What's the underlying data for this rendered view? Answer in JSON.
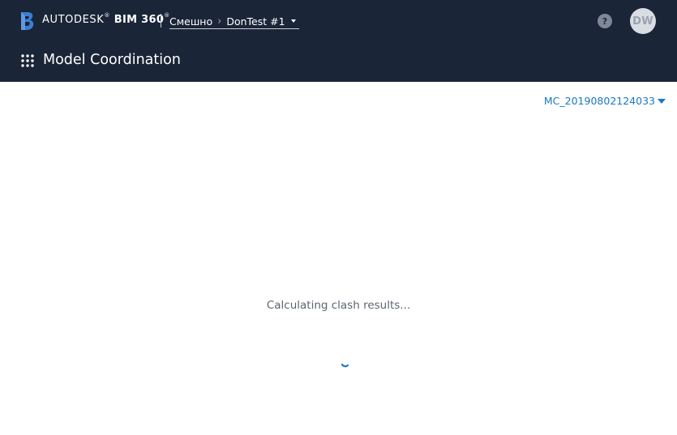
{
  "header": {
    "brand_autodesk": "AUTODESK",
    "brand_trademark": "®",
    "brand_product": "BIM 360",
    "brand_product_mark": "®",
    "breadcrumb": {
      "account": "Смешно",
      "project": "DonTest #1"
    },
    "help_label": "?",
    "user_initials": "DW",
    "module_title": "Model Coordination"
  },
  "main": {
    "model_set": "MC_20190802124033",
    "status_text": "Calculating clash results..."
  },
  "colors": {
    "header_bg": "#1b2538",
    "accent": "#1a78c2",
    "text_muted": "#5c6573"
  },
  "icons": {
    "logo": "bim360-logo-icon",
    "apps": "apps-grid-icon",
    "help": "help-icon",
    "dropdown": "chevron-down-icon",
    "spinner": "loading-spinner-icon"
  }
}
